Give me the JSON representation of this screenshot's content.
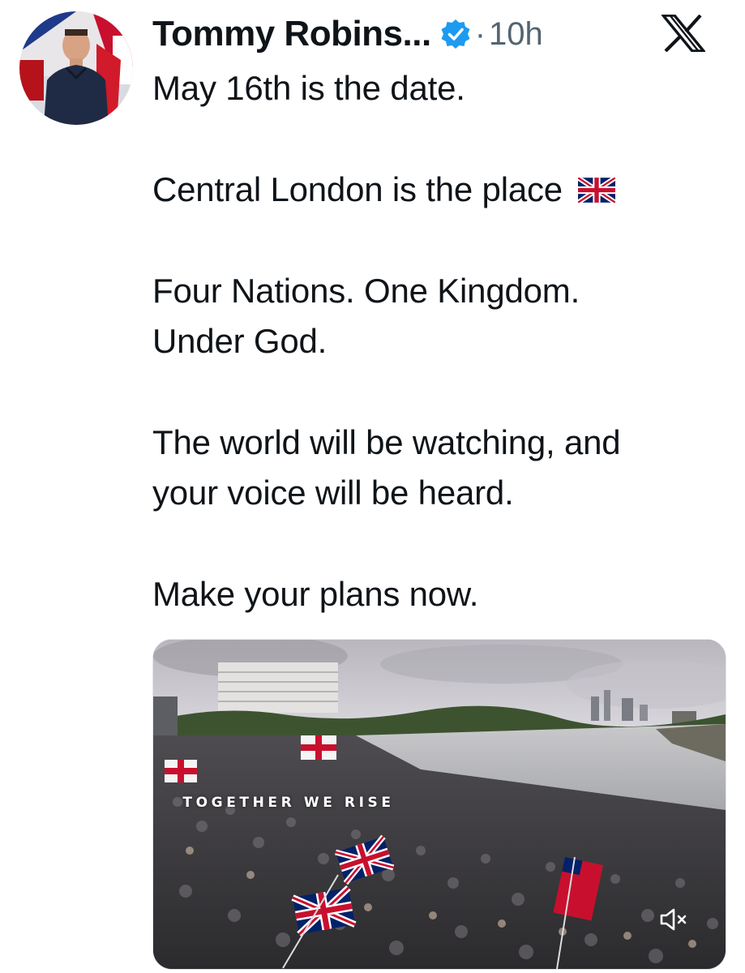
{
  "author": {
    "display_name": "Tommy Robins...",
    "verified": true,
    "separator": "·",
    "timestamp": "10h"
  },
  "brand": {
    "logo": "x-logo-icon",
    "accent_color": "#1d9bf0"
  },
  "tweet": {
    "paragraphs": [
      [
        "May 16th is the date."
      ],
      [
        "Central London is the place"
      ],
      [
        "Four Nations. One Kingdom.",
        "Under God."
      ],
      [
        "The world will be watching, and",
        "your voice will be heard."
      ],
      [
        "Make your plans now."
      ]
    ],
    "emoji_after_paragraph_2": "🇬🇧"
  },
  "media": {
    "type": "video",
    "overlay_text": "TOGETHER WE RISE",
    "muted": true,
    "mute_icon": "speaker-muted-icon"
  }
}
